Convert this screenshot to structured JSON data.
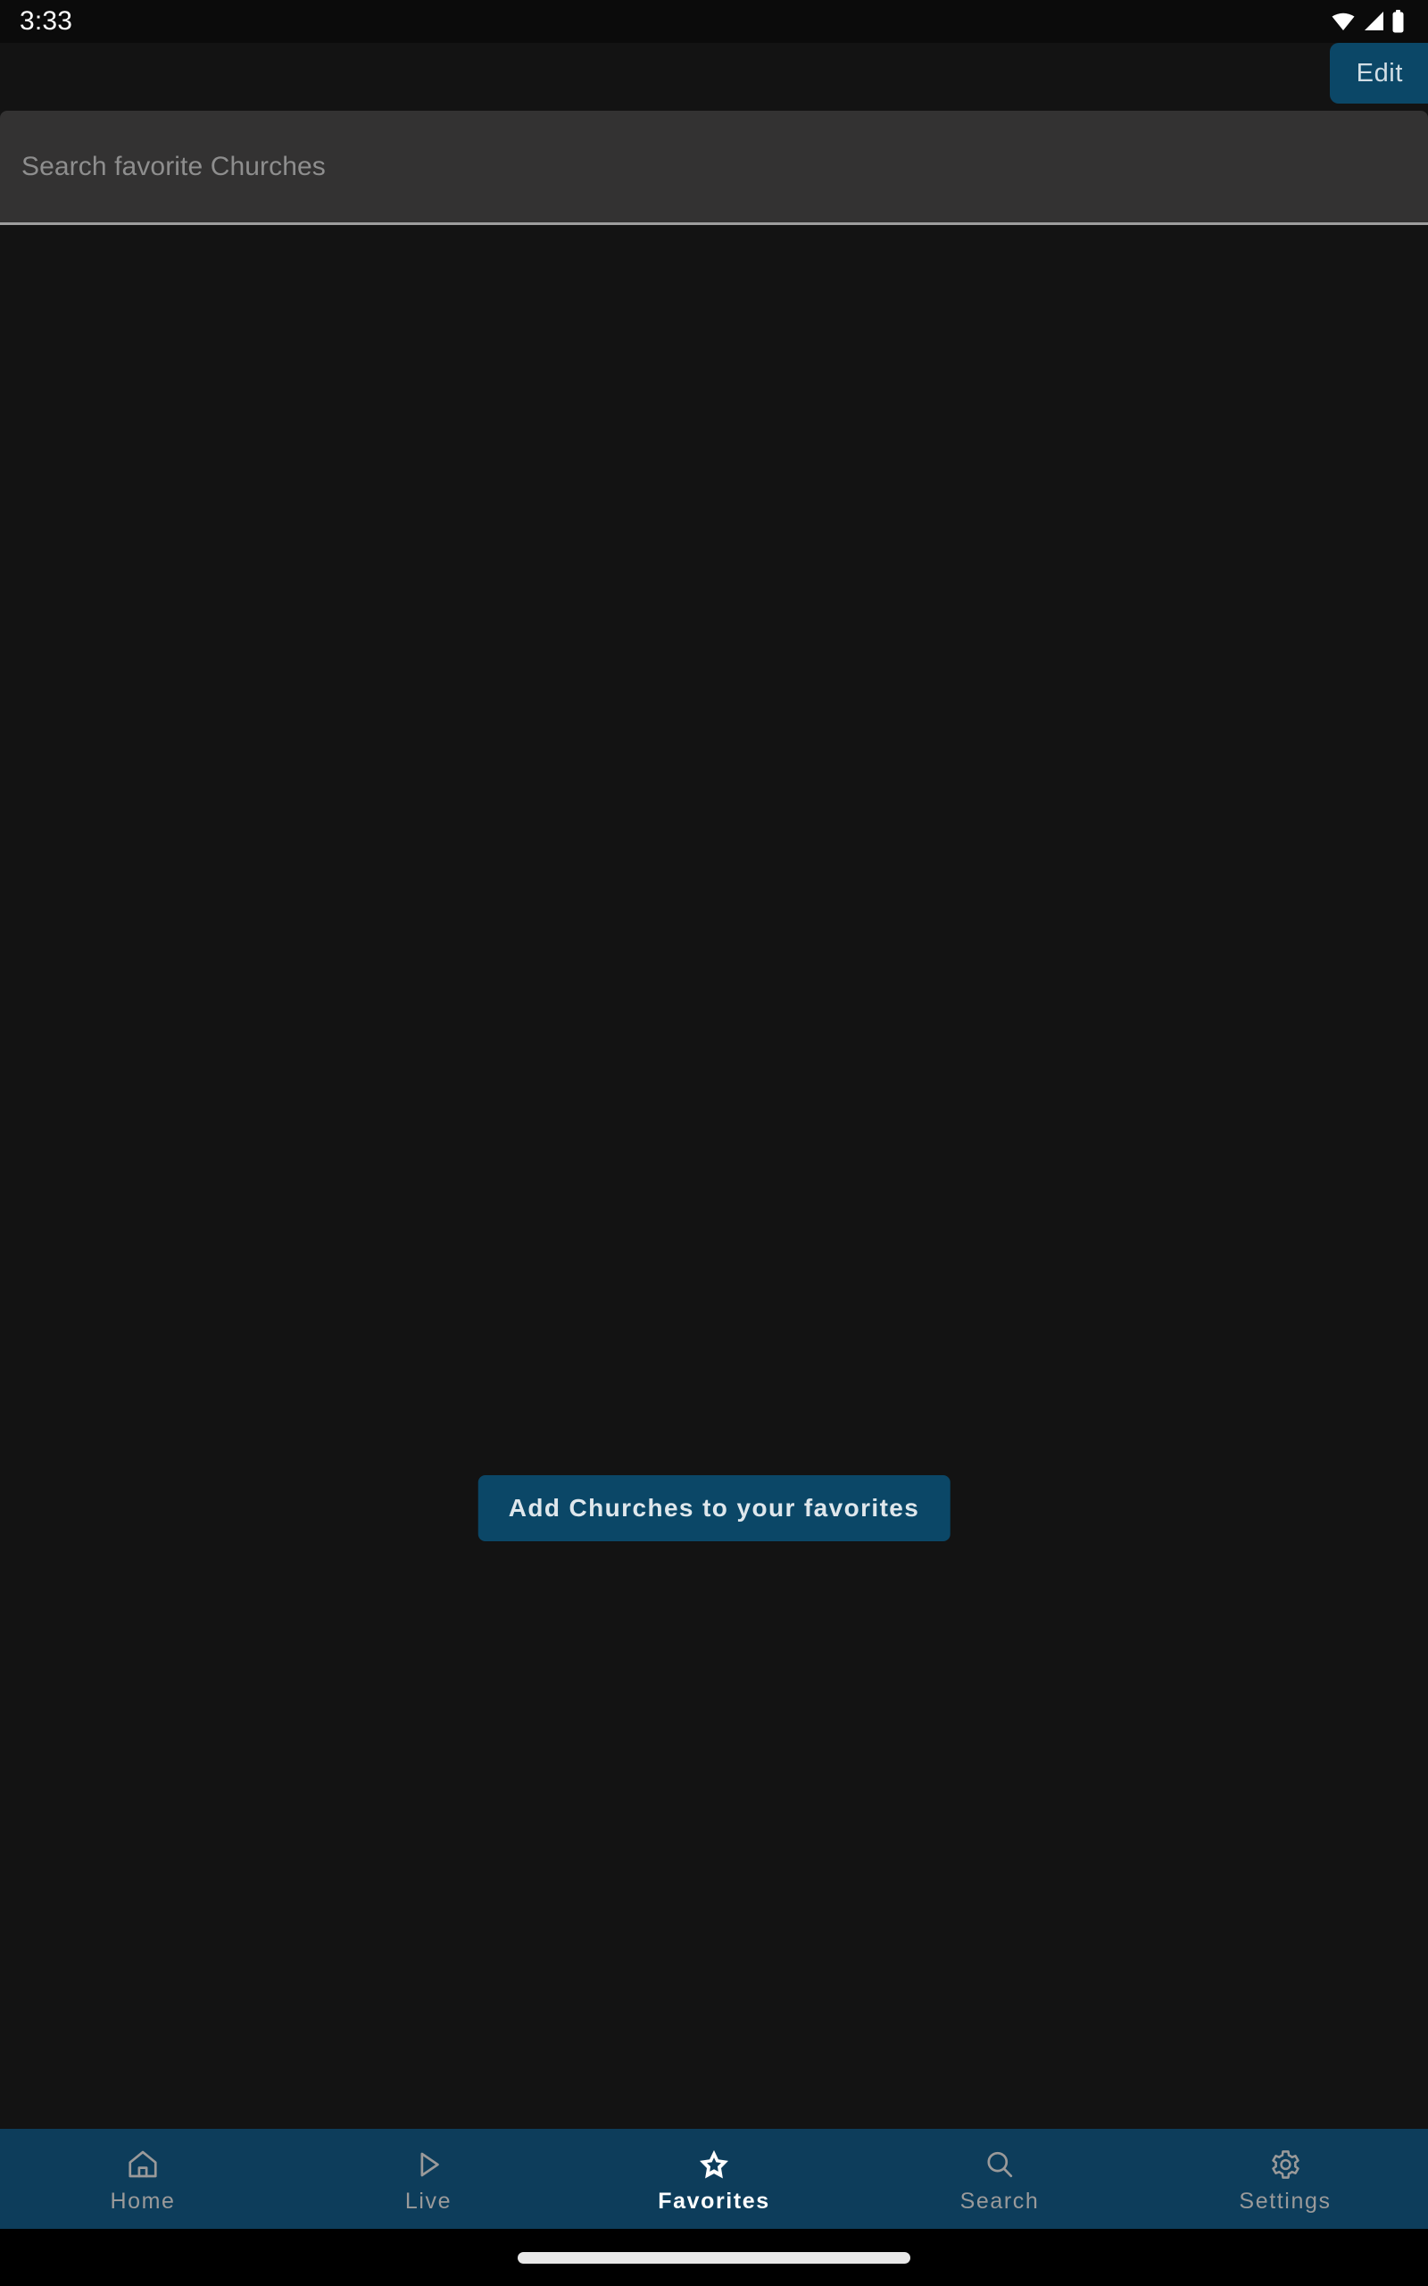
{
  "status_bar": {
    "time": "3:33",
    "icons": [
      "wifi-icon",
      "cellular-signal-icon",
      "battery-icon"
    ]
  },
  "app_bar": {
    "edit_label": "Edit"
  },
  "search": {
    "placeholder": "Search favorite Churches",
    "value": ""
  },
  "main": {
    "empty_state_button": "Add Churches to your favorites"
  },
  "bottom_nav": {
    "items": [
      {
        "label": "Home",
        "icon": "home-icon",
        "active": false
      },
      {
        "label": "Live",
        "icon": "play-icon",
        "active": false
      },
      {
        "label": "Favorites",
        "icon": "star-icon",
        "active": true
      },
      {
        "label": "Search",
        "icon": "search-icon",
        "active": false
      },
      {
        "label": "Settings",
        "icon": "gear-icon",
        "active": false
      }
    ]
  },
  "colors": {
    "background": "#131313",
    "accent": "#0b4767",
    "nav_background": "#0d3d5b",
    "search_background": "#333232",
    "status_background": "#0b0b0b",
    "active_label": "#ffffff",
    "inactive_label": "#9a9a9a",
    "placeholder": "#8e8e8e"
  }
}
